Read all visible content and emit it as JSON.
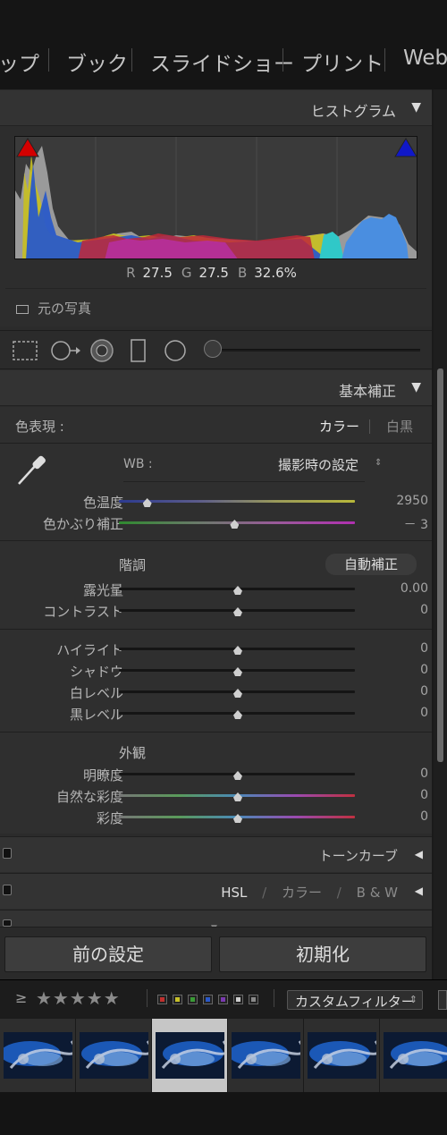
{
  "modules": [
    "ップ",
    "ブック",
    "スライドショー",
    "プリント",
    "Web"
  ],
  "histogram": {
    "title": "ヒストグラム",
    "r_label": "R",
    "r": "27.5",
    "g_label": "G",
    "g": "27.5",
    "b_label": "B",
    "b": "32.6",
    "pct": "%",
    "original_photo": "元の写真"
  },
  "basic": {
    "title": "基本補正",
    "color_mode_label": "色表現 :",
    "color": "カラー",
    "bw": "白黒",
    "wb_label": "WB :",
    "wb_value": "撮影時の設定",
    "temp_label": "色温度",
    "temp_value": "2950",
    "temp_pos": 0.12,
    "tint_label": "色かぶり補正",
    "tint_value": "－ 3",
    "tint_pos": 0.49,
    "tone_head": "階調",
    "auto": "自動補正",
    "exposure_label": "露光量",
    "exposure_value": "0.00",
    "contrast_label": "コントラスト",
    "contrast_value": "0",
    "highlights_label": "ハイライト",
    "highlights_value": "0",
    "shadows_label": "シャドウ",
    "shadows_value": "0",
    "whites_label": "白レベル",
    "whites_value": "0",
    "blacks_label": "黒レベル",
    "blacks_value": "0",
    "presence_head": "外観",
    "clarity_label": "明瞭度",
    "clarity_value": "0",
    "vibrance_label": "自然な彩度",
    "vibrance_value": "0",
    "saturation_label": "彩度",
    "saturation_value": "0"
  },
  "tone_curve": "トーンカーブ",
  "hsl": {
    "hsl": "HSL",
    "color": "カラー",
    "bw": "B & W",
    "slash": "/"
  },
  "buttons": {
    "previous": "前の設定",
    "reset": "初期化"
  },
  "filter": {
    "gte": "≥",
    "stars": "★★★★★",
    "custom": "カスタムフィルター"
  },
  "colors": {
    "accent_red": "#d40000",
    "accent_blue": "#1018c8",
    "label_colors": [
      "#c0302e",
      "#c8c02a",
      "#3a9a36",
      "#2a58c8",
      "#7a3ab0",
      "#cfcfcf",
      "#8a8a8a"
    ]
  }
}
